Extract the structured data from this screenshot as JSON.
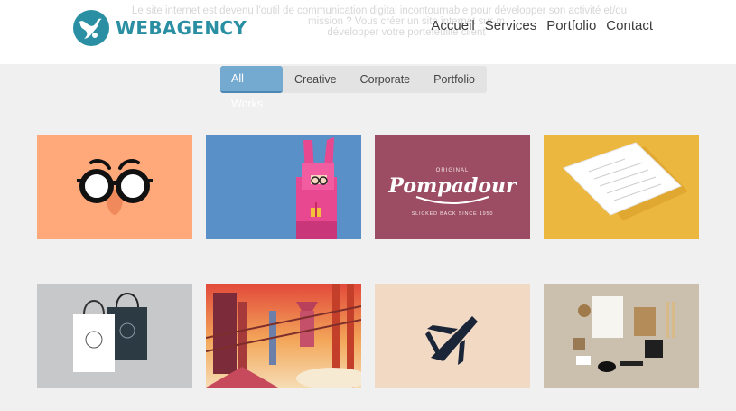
{
  "header": {
    "ghost_text": [
      "Le site internet est devenu l'outil de communication digital incontournable pour développer son activité et/ou",
      "mission ? Vous créer un site internet sur-m",
      "développer votre portefeuille client"
    ],
    "logo_text": "WEBAGENCY",
    "nav": [
      "Accueil",
      "Services",
      "Portfolio",
      "Contact"
    ]
  },
  "filters": {
    "items": [
      "All Works",
      "Creative",
      "Corporate",
      "Portfolio"
    ],
    "active": "All Works"
  },
  "portfolio": {
    "items": [
      {
        "icon": "glasses-icon",
        "bg": "#ffa87a"
      },
      {
        "icon": "rabbit-character-icon",
        "bg": "#5990c8"
      },
      {
        "icon": "pompadour-logo",
        "bg": "#9c4d63",
        "text": "Pompadour",
        "subtext_top": "ORIGINAL",
        "subtext_bottom": "SLICKED BACK SINCE 1950"
      },
      {
        "icon": "stationery-icon",
        "bg": "#ebb73e"
      },
      {
        "icon": "shopping-bags-icon",
        "bg": "#c7c8ca"
      },
      {
        "icon": "city-illustration-icon",
        "bg": "#ee7b35"
      },
      {
        "icon": "plane-logo-icon",
        "bg": "#f2d9c4"
      },
      {
        "icon": "branding-mockup-icon",
        "bg": "#cbbfae"
      }
    ]
  },
  "colors": {
    "brand": "#2a8fa2",
    "tab_active": "#74a9d0"
  }
}
